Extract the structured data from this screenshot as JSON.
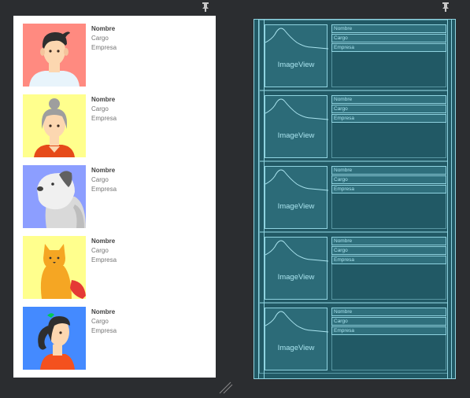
{
  "design": {
    "rows": [
      {
        "avatar": "man-avatar-icon",
        "avatar_bg": "#ff8a80",
        "name": "Nombre",
        "job": "Cargo",
        "company": "Empresa"
      },
      {
        "avatar": "grandma-avatar-icon",
        "avatar_bg": "#ffff8d",
        "name": "Nombre",
        "job": "Cargo",
        "company": "Empresa"
      },
      {
        "avatar": "dog-avatar-icon",
        "avatar_bg": "#8c9eff",
        "name": "Nombre",
        "job": "Cargo",
        "company": "Empresa"
      },
      {
        "avatar": "cat-avatar-icon",
        "avatar_bg": "#ffff8d",
        "name": "Nombre",
        "job": "Cargo",
        "company": "Empresa"
      },
      {
        "avatar": "woman-avatar-icon",
        "avatar_bg": "#448aff",
        "name": "Nombre",
        "job": "Cargo",
        "company": "Empresa"
      }
    ]
  },
  "blueprint": {
    "image_label": "ImageView",
    "rows": [
      {
        "name": "Nombre",
        "job": "Cargo",
        "company": "Empresa"
      },
      {
        "name": "Nombre",
        "job": "Cargo",
        "company": "Empresa"
      },
      {
        "name": "Nombre",
        "job": "Cargo",
        "company": "Empresa"
      },
      {
        "name": "Nombre",
        "job": "Cargo",
        "company": "Empresa"
      },
      {
        "name": "Nombre",
        "job": "Cargo",
        "company": "Empresa"
      }
    ]
  },
  "colors": {
    "ide_background": "#2b2d30",
    "blueprint_background": "#215965",
    "blueprint_line": "#8fd3e0"
  }
}
